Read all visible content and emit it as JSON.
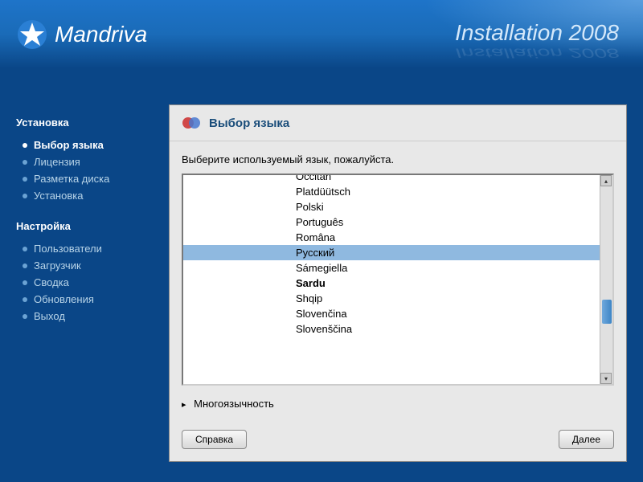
{
  "header": {
    "brand": "Mandriva",
    "title": "Installation 2008"
  },
  "sidebar": {
    "section1_title": "Установка",
    "section1_items": [
      {
        "label": "Выбор языка",
        "active": true
      },
      {
        "label": "Лицензия",
        "active": false
      },
      {
        "label": "Разметка диска",
        "active": false
      },
      {
        "label": "Установка",
        "active": false
      }
    ],
    "section2_title": "Настройка",
    "section2_items": [
      {
        "label": "Пользователи",
        "active": false
      },
      {
        "label": "Загрузчик",
        "active": false
      },
      {
        "label": "Сводка",
        "active": false
      },
      {
        "label": "Обновления",
        "active": false
      },
      {
        "label": "Выход",
        "active": false
      }
    ]
  },
  "panel": {
    "title": "Выбор языка",
    "prompt": "Выберите используемый язык, пожалуйста.",
    "languages": [
      {
        "name": "Occitan",
        "selected": false,
        "bold": false,
        "cut": "top"
      },
      {
        "name": "Platdüütsch",
        "selected": false,
        "bold": false
      },
      {
        "name": "Polski",
        "selected": false,
        "bold": false
      },
      {
        "name": "Português",
        "selected": false,
        "bold": false
      },
      {
        "name": "Româna",
        "selected": false,
        "bold": false
      },
      {
        "name": "Русский",
        "selected": true,
        "bold": false
      },
      {
        "name": "Sámegiella",
        "selected": false,
        "bold": false
      },
      {
        "name": "Sardu",
        "selected": false,
        "bold": true
      },
      {
        "name": "Shqip",
        "selected": false,
        "bold": false
      },
      {
        "name": "Slovenčina",
        "selected": false,
        "bold": false
      },
      {
        "name": "Slovenščina",
        "selected": false,
        "bold": false,
        "cut": "bottom"
      }
    ],
    "expander": "Многоязычность",
    "help_button": "Справка",
    "next_button": "Далее"
  }
}
